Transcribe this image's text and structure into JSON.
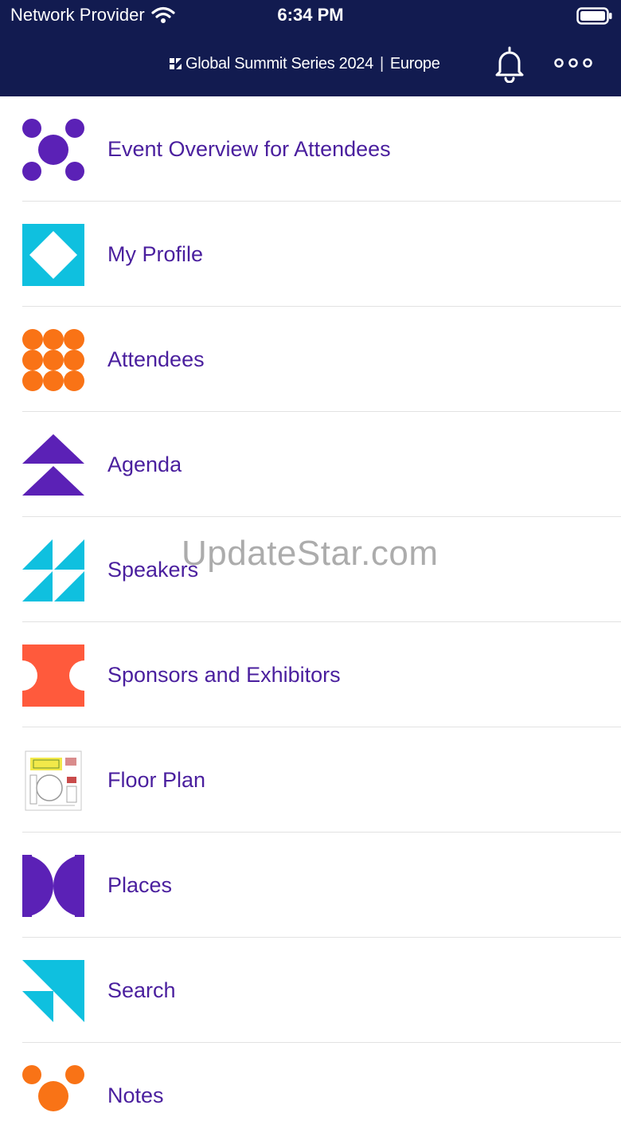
{
  "status_bar": {
    "carrier": "Network Provider",
    "time": "6:34 PM"
  },
  "header": {
    "brand_name": "Global Summit Series 2024",
    "brand_region": "Europe",
    "brand_separator": "|"
  },
  "menu": {
    "items": [
      {
        "label": "Event Overview for Attendees",
        "icon": "dots-cluster-icon"
      },
      {
        "label": "My Profile",
        "icon": "diamond-icon"
      },
      {
        "label": "Attendees",
        "icon": "circle-grid-icon"
      },
      {
        "label": "Agenda",
        "icon": "stacked-triangles-icon"
      },
      {
        "label": "Speakers",
        "icon": "triangle-grid-icon"
      },
      {
        "label": "Sponsors and Exhibitors",
        "icon": "ticket-icon"
      },
      {
        "label": "Floor Plan",
        "icon": "floor-plan-thumbnail-icon"
      },
      {
        "label": "Places",
        "icon": "half-circles-icon"
      },
      {
        "label": "Search",
        "icon": "arrow-shapes-icon"
      },
      {
        "label": "Notes",
        "icon": "notes-dots-icon"
      }
    ]
  },
  "watermark": "UpdateStar.com",
  "colors": {
    "header_bg": "#121b50",
    "label_text": "#4a1f9e",
    "purple": "#5b21b6",
    "cyan": "#0fc0df",
    "orange": "#f97316",
    "coral": "#ff5a3c"
  }
}
